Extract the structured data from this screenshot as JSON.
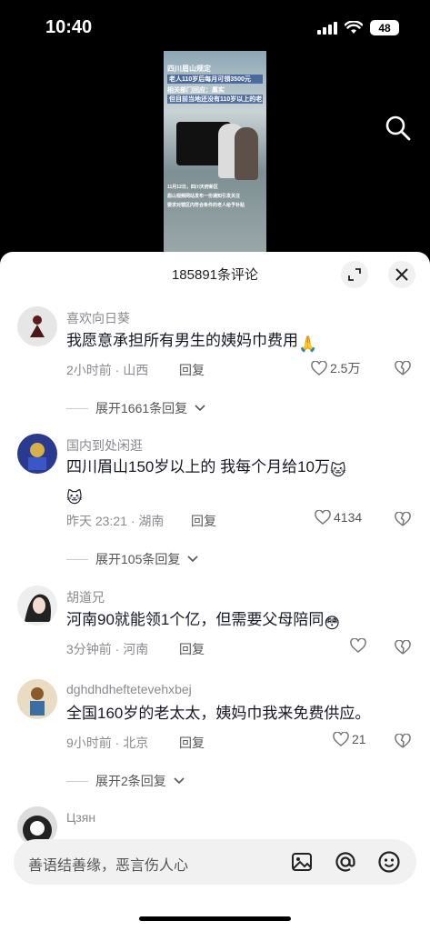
{
  "status_bar": {
    "time": "10:40",
    "battery": "48"
  },
  "video": {
    "caption_lines": [
      "四川眉山规定",
      "老人110岁后每月可领3500元",
      "相关部门回应：属实",
      "但目前当地还没有110岁以上的老人"
    ],
    "sub_caption_lines": [
      "11月12日，四川天府新区",
      "眉山视频网站发布一份通知引发关注",
      "要求对辖区内符合条件的老人给予补贴"
    ]
  },
  "comments_sheet": {
    "title": "185891条评论",
    "comments": [
      {
        "user": "喜欢向日葵",
        "text": "我愿意承担所有男生的姨妈巾费用",
        "emoji": "🙏",
        "meta": "2小时前 · 山西",
        "reply_label": "回复",
        "likes": "2.5万",
        "expand_label": "展开1661条回复"
      },
      {
        "user": "国内到处闲逛",
        "text": "四川眉山150岁以上的   我每个月给10万",
        "emoji": "🐱",
        "meta": "昨天 23:21 · 湖南",
        "reply_label": "回复",
        "likes": "4134",
        "expand_label": "展开105条回复"
      },
      {
        "user": "胡道兄",
        "text": "河南90就能领1个亿，但需要父母陪同",
        "emoji": "😳",
        "meta": "3分钟前 · 河南",
        "reply_label": "回复",
        "likes": ""
      },
      {
        "user": "dghdhdheftetevehxbej",
        "text": "全国160岁的老太太，姨妈巾我来免费供应。",
        "meta": "9小时前 · 北京",
        "reply_label": "回复",
        "likes": "21",
        "expand_label": "展开2条回复"
      },
      {
        "user": "Цзян"
      }
    ]
  },
  "input_bar": {
    "placeholder": "善语结善缘，恶言伤人心"
  },
  "colors": {
    "accent_text": "#161823",
    "meta_text": "#8a8a8f",
    "sheet_bg": "#ffffff"
  }
}
